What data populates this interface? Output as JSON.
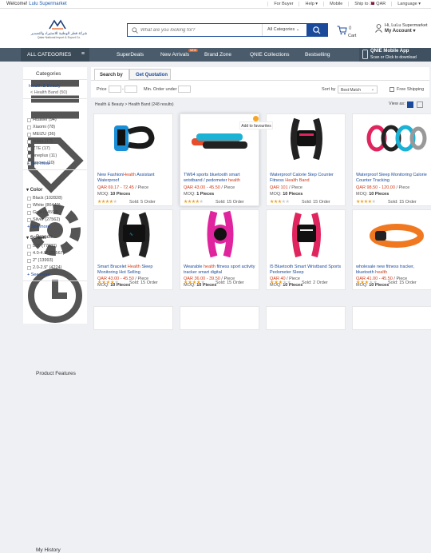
{
  "topbar": {
    "welcome": "Welcome!",
    "store": "Lulu Supermarket",
    "links": [
      "For Buyer",
      "Help ▾",
      "Mobile",
      "Ship to 🇶🇦 QAR",
      "Language ▾"
    ]
  },
  "header": {
    "logo_ar": "شركة قطر الوطنية للاستيراد والتصدير",
    "logo_en": "Qatar National Import & Export Co.",
    "search_placeholder": "What are you looking for?",
    "category_select": "All Categories",
    "cart_count": "0",
    "cart_label": "Cart",
    "greeting": "Hi, LuLu Supermarket",
    "my_account": "My Account ▾"
  },
  "nav": {
    "all_categories": "ALL CATEGORIES",
    "items": [
      "SuperDeals",
      "New Arrivals",
      "Brand Zone",
      "QNIE Collections",
      "Bestselling"
    ],
    "new_badge": "NEW",
    "app_title": "QNIE Mobile App",
    "app_sub": "Scan or Click to download"
  },
  "sidebar": {
    "categories_title": "Categories",
    "category": "Health & Beauty",
    "subcategory": "< Health Band (50)",
    "brands_title": "Brands",
    "brands": [
      "Huawei (94)",
      "Xiaomi (78)",
      "MEIZU (36)",
      "nubia (17)",
      "ZTE (17)",
      "oneplus (11)",
      "lenovo (10)"
    ],
    "see_more": "+ See more",
    "features_title": "Product Features",
    "color_title": "Color",
    "colors": [
      "Black (102828)",
      "White (86440)",
      "Gold (14594)",
      "Silver (27562)"
    ],
    "screen_title": "Screen",
    "screens": [
      "5.0\" (77380)",
      "4.0-4.9\" (20567)",
      "2\" (13993)",
      "2.0-2.9\" (4224)"
    ],
    "history_title": "My History"
  },
  "filter": {
    "tab_search": "Search by",
    "tab_quotation": "Get Quotation",
    "price_label": "Price",
    "min_order_label": "Min. Order under",
    "sort_label": "Sort by",
    "sort_value": "Best Match",
    "free_shipping": "Free Shipping"
  },
  "results": {
    "breadcrumb": "Health & Beauty > Health Band (248 results)",
    "view_as": "View as:",
    "add_fav": "Add to favourites"
  },
  "products": [
    {
      "t1": "New Fashion",
      "hl": "Health",
      "t2": " Assistant Waterproof",
      "price": "QAR 69.17 - 72.45",
      "unit": " / Piece",
      "moq": "10 Pieces",
      "stars": 4,
      "sold": "Sold: 5 Order"
    },
    {
      "t1": "TW64 sports bluetooth smart wristband / pedometer ",
      "hl": "health",
      "t2": "",
      "price": "QAR 43.00 - 45.50",
      "unit": " / Piece",
      "moq": "1 Pieces",
      "stars": 4,
      "sold": "Sold: 15 Order"
    },
    {
      "t1": "Waterproof Calorie Step Counter Fitness ",
      "hl": "Health Band",
      "t2": "",
      "price": "QAR 101",
      "unit": " / Piece",
      "moq": "10 Pieces",
      "stars": 3,
      "sold": "Sold: 15 Order"
    },
    {
      "t1": "Waterproof Sleep Monitoring Calorie Counter Tracking",
      "hl": "",
      "t2": "",
      "price": "QAR 98.50 - 120.00",
      "unit": " / Piece",
      "moq": "10 Pieces",
      "stars": 4,
      "sold": "Sold: 15 Order"
    },
    {
      "t1": "Smart Bracelet ",
      "hl": "Health",
      "t2": " Sleep Monitoring Hot Selling",
      "price": "QAR 43.00 - 45.50",
      "unit": " / Piece",
      "moq": "10 Pieces",
      "stars": 4,
      "sold": "Sold: 15 Order"
    },
    {
      "t1": "Wearable ",
      "hl": "health",
      "t2": " fitness sport activity tracker smart digital",
      "price": "QAR 36.00 - 39.50",
      "unit": " / Piece",
      "moq": "10 Pieces",
      "stars": 4,
      "sold": "Sold: 15 Order"
    },
    {
      "t1": "I5 Bluetooth Smart Wristband Sports Pedometer Sleep",
      "hl": "",
      "t2": "",
      "price": "QAR 40",
      "unit": " / Piece",
      "moq": "10 Pieces",
      "stars": 3,
      "sold": "Sold: 2 Order"
    },
    {
      "t1": "wholesale new fitness tracker, bluetooth ",
      "hl": "health",
      "t2": "",
      "price": "QAR 41.00 - 45.50",
      "unit": " / Piece",
      "moq": "10 Pieces",
      "stars": 3,
      "sold": "Sold: 15 Order"
    }
  ]
}
